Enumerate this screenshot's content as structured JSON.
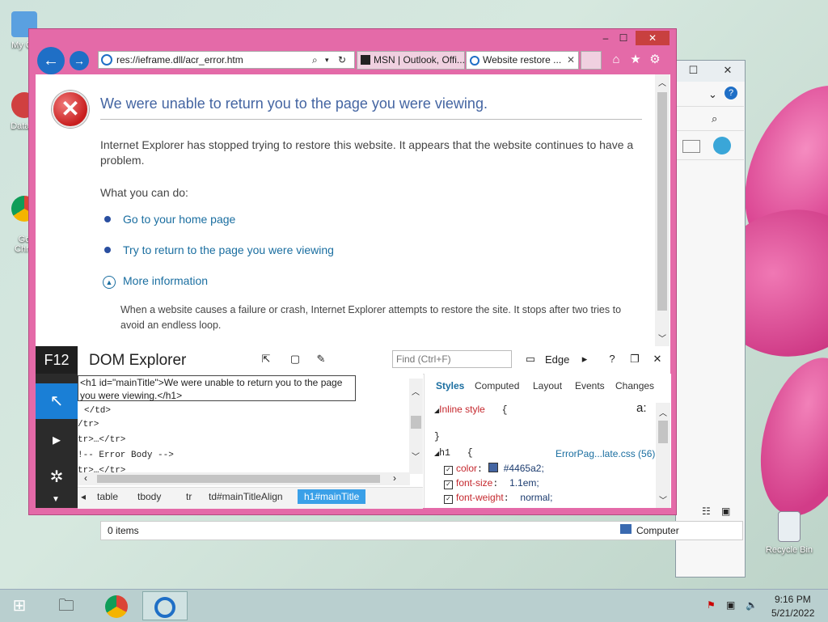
{
  "desktop": {
    "icons": [
      {
        "label": "My Co"
      },
      {
        "label": "DataW"
      },
      {
        "label": "Goo\nChro"
      },
      {
        "label": "Recycle Bin"
      }
    ]
  },
  "ie": {
    "address": "res://ieframe.dll/acr_error.htm",
    "tabs": [
      {
        "label": "MSN | Outlook, Offi..."
      },
      {
        "label": "Website restore ..."
      }
    ],
    "page": {
      "title": "We were unable to return you to the page you were viewing.",
      "description": "Internet Explorer has stopped trying to restore this website. It appears that the website continues to have a problem.",
      "what_you_can_do": "What you can do:",
      "link_home": "Go to your home page",
      "link_return": "Try to return to the page you were viewing",
      "more_info": "More information",
      "more_info_text": "When a website causes a failure or crash, Internet Explorer attempts to restore the site. It stops after two tries to avoid an endless loop."
    }
  },
  "devtools": {
    "f12": "F12",
    "title": "DOM Explorer",
    "find_placeholder": "Find (Ctrl+F)",
    "edge_label": "Edge",
    "tooltip": "<h1 id=\"mainTitle\">We were unable to return you to the page you were viewing.</h1>",
    "dom_lines": [
      "</td>",
      "/tr>",
      "tr>…</tr>",
      "!-- Error Body -->",
      "tr>…</tr>"
    ],
    "breadcrumb": [
      "table",
      "tbody",
      "tr",
      "td#mainTitleAlign",
      "h1#mainTitle"
    ],
    "style_tabs": [
      "Styles",
      "Computed",
      "Layout",
      "Events",
      "Changes"
    ],
    "inline_style": "Inline style",
    "brace_open": "{",
    "brace_close": "}",
    "h1_selector": "h1",
    "source": "ErrorPag...late.css (56)",
    "properties": [
      {
        "name": "color",
        "value": "#4465a2;"
      },
      {
        "name": "font-size",
        "value": "1.1em;"
      },
      {
        "name": "font-weight",
        "value": "normal;"
      }
    ]
  },
  "explorer_status": {
    "items": "0 items",
    "location": "Computer"
  },
  "taskbar": {
    "time": "9:16 PM",
    "date": "5/21/2022"
  },
  "colors": {
    "ie_frame": "#e46aa8",
    "title_blue": "#4465a2",
    "link_blue": "#1a6ea0"
  }
}
